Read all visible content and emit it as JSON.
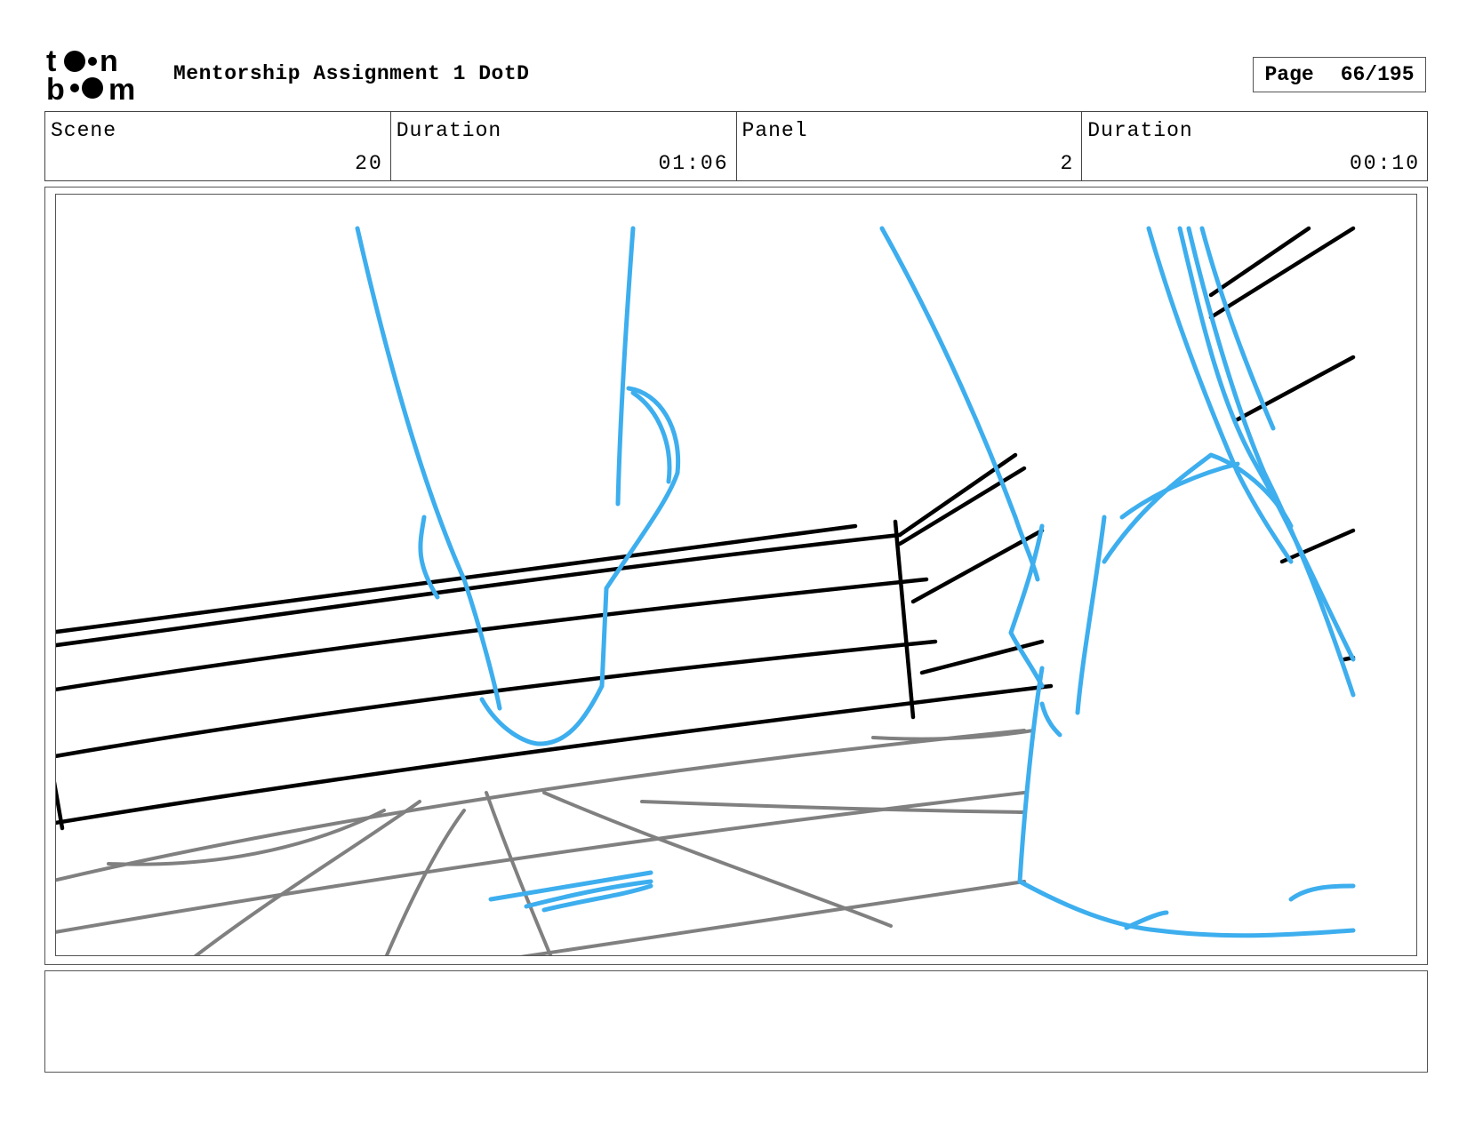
{
  "header": {
    "logo_text": "toon boom",
    "title": "Mentorship Assignment 1 DotD",
    "page_label": "Page",
    "page_value": "66/195"
  },
  "info": {
    "scene_label": "Scene",
    "scene_value": "20",
    "scene_duration_label": "Duration",
    "scene_duration_value": "01:06",
    "panel_label": "Panel",
    "panel_value": "2",
    "panel_duration_label": "Duration",
    "panel_duration_value": "00:10"
  },
  "sketch": {
    "line_color": "#000000",
    "floor_color": "#808080",
    "character_color": "#3daeee"
  },
  "notes": {
    "text": ""
  }
}
